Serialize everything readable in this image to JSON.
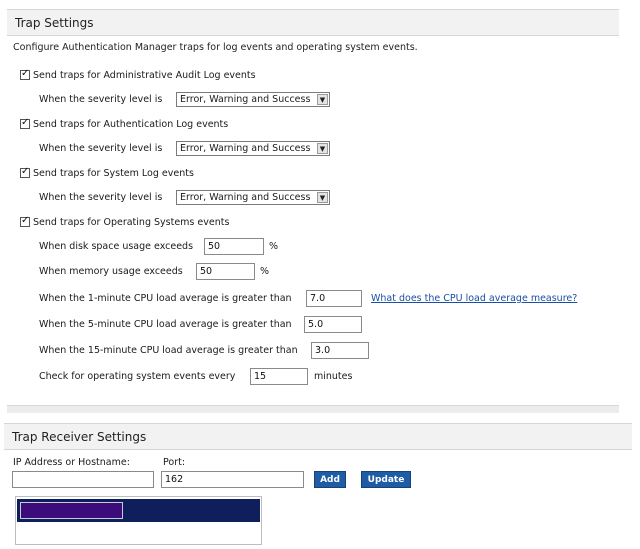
{
  "trap_settings": {
    "title": "Trap Settings",
    "description": "Configure Authentication Manager traps for log events and operating system events.",
    "audit": {
      "checkbox_label": "Send traps for Administrative Audit Log events",
      "checked": true,
      "severity_label": "When the severity level is",
      "severity_value": "Error, Warning and Success"
    },
    "auth": {
      "checkbox_label": "Send traps for Authentication Log events",
      "checked": true,
      "severity_label": "When the severity level is",
      "severity_value": "Error, Warning and Success"
    },
    "system": {
      "checkbox_label": "Send traps for System Log events",
      "checked": true,
      "severity_label": "When the severity level is",
      "severity_value": "Error, Warning and Success"
    },
    "os": {
      "checkbox_label": "Send traps for Operating Systems events",
      "checked": true,
      "disk_label": "When disk space usage exceeds",
      "disk_value": "50",
      "disk_unit": "%",
      "memory_label": "When memory usage exceeds",
      "memory_value": "50",
      "memory_unit": "%",
      "cpu1_label": "When the 1-minute CPU load average is greater than",
      "cpu1_value": "7.0",
      "cpu_help_link": "What does the CPU load average measure?",
      "cpu5_label": "When the 5-minute CPU load average is greater than",
      "cpu5_value": "5.0",
      "cpu15_label": "When the 15-minute CPU load average is greater than",
      "cpu15_value": "3.0",
      "check_label": "Check for operating system events every",
      "check_value": "15",
      "check_unit": "minutes"
    }
  },
  "receiver": {
    "title": "Trap Receiver Settings",
    "ip_label": "IP Address or Hostname:",
    "ip_value": "",
    "port_label": "Port:",
    "port_value": "162",
    "add_label": "Add",
    "update_label": "Update"
  },
  "icons": {
    "checkmark": "checkmark-icon",
    "dropdown": "chevron-down-icon"
  },
  "colors": {
    "button": "#1f5ca6",
    "list_selection": "#0f1f5c",
    "link": "#1a4fa3"
  }
}
